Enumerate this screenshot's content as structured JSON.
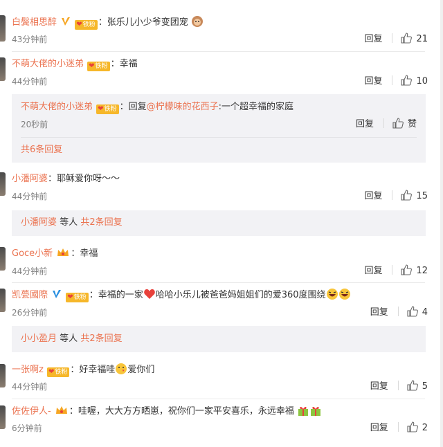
{
  "comments": [
    {
      "user": "白鬓相思醉",
      "text": "张乐儿小少爷变团宠",
      "time": "43分钟前",
      "reply": "回复",
      "likes": "21",
      "badges": [
        "v",
        "fan"
      ],
      "emoji": "monkey-emoji"
    },
    {
      "user": "不萌大佬的小迷弟",
      "text": "幸福",
      "time": "44分钟前",
      "reply": "回复",
      "likes": "10",
      "badges": [
        "fan"
      ],
      "sub": {
        "user": "不萌大佬的小迷弟",
        "prefix": "回复",
        "mention": "@柠檬味的花西子",
        "text": ":一个超幸福的家庭",
        "time": "20秒前",
        "reply": "回复",
        "like_label": "赞",
        "more": "共6条回复"
      }
    },
    {
      "user": "小潘阿婆",
      "text": "耶稣爱你呀～～",
      "time": "44分钟前",
      "reply": "回复",
      "likes": "15",
      "badges": [],
      "sub": {
        "user": "小潘阿婆",
        "mid": "等人",
        "more": "共2条回复"
      }
    },
    {
      "user": "Goce小新",
      "text": "幸福",
      "time": "44分钟前",
      "reply": "回复",
      "likes": "12",
      "badges": [
        "crown"
      ]
    },
    {
      "user": "凯甍國際",
      "text_a": "幸福的一家",
      "text_b": "哈哈小乐儿被爸爸妈姐姐们的爱360度围绕",
      "time": "26分钟前",
      "reply": "回复",
      "likes": "4",
      "badges": [
        "v",
        "fan"
      ],
      "sub": {
        "user": "小小盈月",
        "mid": "等人",
        "more": "共2条回复"
      }
    },
    {
      "user": "一张啊z",
      "text_a": "好幸福哇",
      "text_b": "爱你们",
      "time": "44分钟前",
      "reply": "回复",
      "likes": "5",
      "badges": [
        "fan"
      ]
    },
    {
      "user": "佐佐伊人-",
      "text": "哇喔，大大方方晒崽，祝你们一家平安喜乐，永远幸福",
      "time": "6分钟前",
      "reply": "回复",
      "likes": "2",
      "badges": [
        "crown"
      ]
    }
  ],
  "badge_fan_label": "铁粉",
  "colors": {
    "username": "#eb7350",
    "subbox": "#f2f2f5",
    "time": "#808080"
  }
}
